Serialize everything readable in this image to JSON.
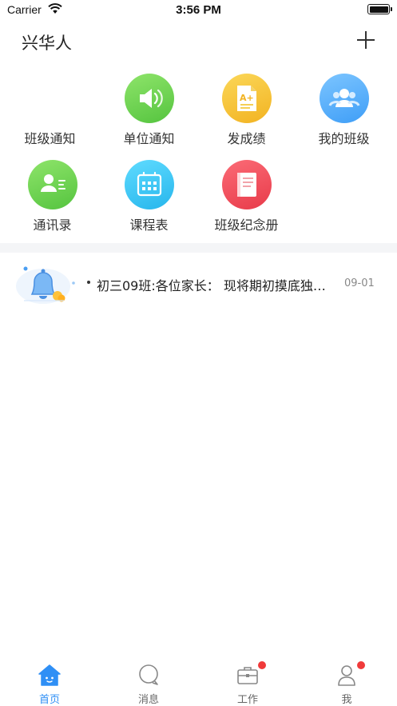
{
  "status_bar": {
    "carrier": "Carrier",
    "time": "3:56 PM"
  },
  "nav": {
    "title": "兴华人"
  },
  "grid": [
    {
      "label": "班级通知",
      "icon": "class-notice-icon",
      "color": ""
    },
    {
      "label": "单位通知",
      "icon": "speaker-icon",
      "color": "#6fd158"
    },
    {
      "label": "发成绩",
      "icon": "grade-paper-icon",
      "color": "#f6c238"
    },
    {
      "label": "我的班级",
      "icon": "class-people-icon",
      "color": "#5ab0fb"
    },
    {
      "label": "通讯录",
      "icon": "contact-card-icon",
      "color": "#74d45a"
    },
    {
      "label": "课程表",
      "icon": "timetable-icon",
      "color": "#36c6f2"
    },
    {
      "label": "班级纪念册",
      "icon": "album-book-icon",
      "color": "#f2505e"
    }
  ],
  "messages": [
    {
      "text": "初三09班:各位家长： 现将期初摸底独…",
      "date": "09-01"
    }
  ],
  "tabs": [
    {
      "label": "首页",
      "icon": "home-icon",
      "active": true,
      "badge": false
    },
    {
      "label": "消息",
      "icon": "chat-bubble-icon",
      "active": false,
      "badge": false
    },
    {
      "label": "工作",
      "icon": "briefcase-icon",
      "active": false,
      "badge": true
    },
    {
      "label": "我",
      "icon": "person-icon",
      "active": false,
      "badge": true
    }
  ],
  "colors": {
    "accent": "#2f8ff5",
    "badge": "#f03a3a",
    "divider": "#f4f5f7"
  }
}
